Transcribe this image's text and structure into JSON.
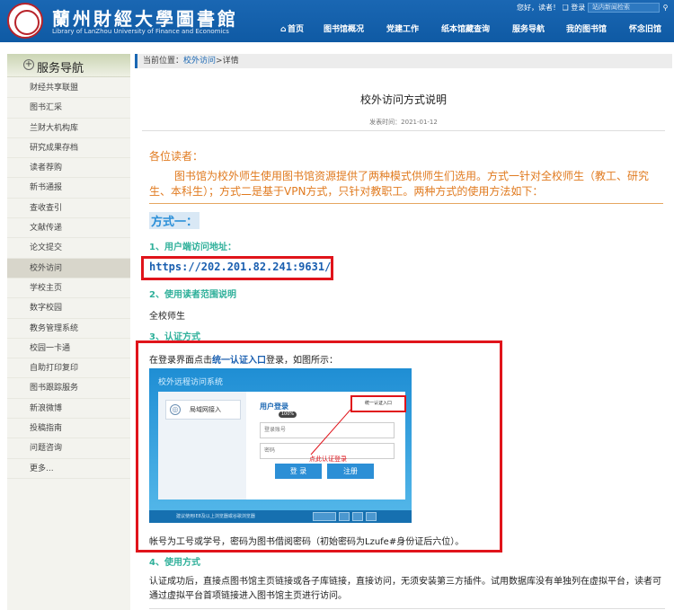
{
  "header": {
    "logo_title": "蘭州財經大學圖書館",
    "logo_subtitle": "Library of LanZhou University of Finance and Economics",
    "greeting": "您好，读者！",
    "login_label": "登录",
    "search_placeholder": "站内新闻检索",
    "nav": [
      "首页",
      "图书馆概况",
      "党建工作",
      "纸本馆藏查询",
      "服务导航",
      "我的图书馆",
      "怀念旧馆"
    ]
  },
  "sidebar": {
    "title": "服务导航",
    "items": [
      "财经共享联盟",
      "图书汇采",
      "兰财大机构库",
      "研究成果存档",
      "读者荐购",
      "新书通报",
      "查收查引",
      "文献传递",
      "论文提交",
      "校外访问",
      "学校主页",
      "数字校园",
      "教务管理系统",
      "校园一卡通",
      "自助打印复印",
      "图书跟踪服务",
      "新浪微博",
      "投稿指南",
      "问题咨询",
      "更多..."
    ],
    "active_index": 9
  },
  "breadcrumb": {
    "prefix": "当前位置：",
    "link": "校外访问",
    "sep": ">",
    "current": "详情"
  },
  "article": {
    "title": "校外访问方式说明",
    "date": "发表时间：2021-01-12",
    "greeting": "各位读者：",
    "intro": "图书馆为校外师生使用图书馆资源提供了两种模式供师生们选用。方式一针对全校师生（教工、研究生、本科生）；方式二是基于VPN方式，只针对教职工。两种方式的使用方法如下：",
    "mode1": "方式一：",
    "sec1": "1、用户端访问地址：",
    "url": "https://202.201.82.241:9631/",
    "sec2": "2、使用读者范围说明",
    "scope": "全校师生",
    "sec3": "3、认证方式",
    "login_prefix": "在登录界面点击",
    "login_link": "统一认证入口",
    "login_suffix": "登录，如图所示：",
    "account": "帐号为工号或学号，密码为图书借阅密码（初始密码为Lzufe#身份证后六位）。",
    "sec4": "4、使用方式",
    "usage": "认证成功后，直接点图书馆主页链接或各子库链接，直接访问，无须安装第三方插件。试用数据库没有单独列在虚拟平台，读者可通过虚拟平台首项链接进入图书馆主页进行访问。"
  },
  "screenshot": {
    "title": "校外远程访问系统",
    "left_item": "局域网接入",
    "login_title": "用户登录",
    "pill": "100%",
    "account_placeholder": "登录账号",
    "password_placeholder": "密码",
    "login_btn": "登 录",
    "register_btn": "注册",
    "anno_box": "统一认证入口",
    "anno_text": "点此认证登录",
    "footer": "建议使用IE8及以上浏览器或谷歌浏览器"
  },
  "colors": {
    "header_blue": "#1a67b3",
    "accent_orange": "#e07a1f",
    "section_teal": "#2fb09a",
    "highlight_red": "#e0141b"
  }
}
